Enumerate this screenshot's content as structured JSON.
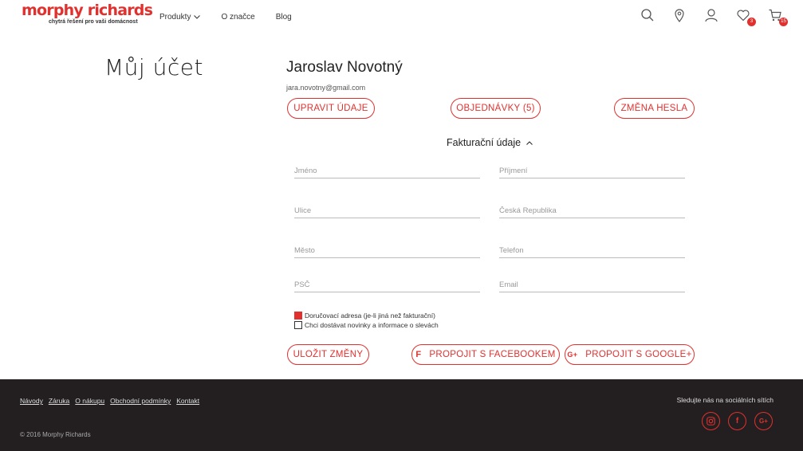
{
  "header": {
    "logo_text": "morphy richards",
    "tagline": "chytrá řešení pro vaši domácnost",
    "nav": [
      {
        "label": "Produkty"
      },
      {
        "label": "O značce"
      },
      {
        "label": "Blog"
      }
    ],
    "wishlist_count": "3",
    "cart_count": "15"
  },
  "page": {
    "title": "Můj účet",
    "user_name": "Jaroslav Novotný",
    "user_email": "jara.novotny@gmail.com"
  },
  "actions": {
    "edit": "UPRAVIT ÚDAJE",
    "orders": "OBJEDNÁVKY (5)",
    "password": "ZMĚNA HESLA"
  },
  "billing": {
    "section_label": "Fakturační údaje",
    "fields": {
      "first_name": "Jméno",
      "last_name": "Příjmení",
      "street": "Ulice",
      "country": "Česká Republika",
      "city": "Město",
      "phone": "Telefon",
      "zip": "PSČ",
      "email": "Email"
    },
    "checkboxes": [
      {
        "label": "Doručovací adresa (je-li jiná než fakturační)",
        "checked": true
      },
      {
        "label": "Chci dostávat novinky a informace o slevách",
        "checked": false
      }
    ]
  },
  "buttons": {
    "save": "ULOŽIT ZMĚNY",
    "facebook": "PROPOJIT S FACEBOOKEM",
    "google": "PROPOJIT S GOOGLE+"
  },
  "footer": {
    "links": [
      "Návody",
      "Záruka",
      "O nákupu",
      "Obchodní podmínky",
      "Kontakt"
    ],
    "copyright": "© 2016 Morphy Richards",
    "social_title": "Sledujte nás na sociálních sítích",
    "social": [
      "instagram-icon",
      "facebook-icon",
      "google-plus-icon"
    ]
  },
  "colors": {
    "accent": "#e0312f",
    "footer_bg": "#231f20"
  }
}
